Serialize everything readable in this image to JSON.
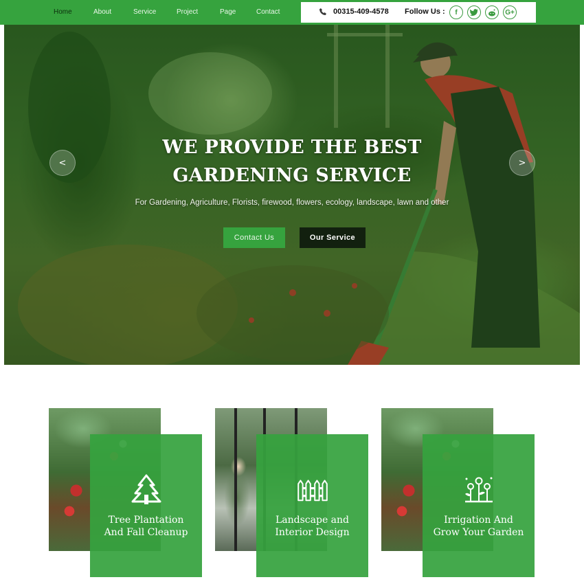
{
  "nav": {
    "items": [
      {
        "label": "Home",
        "active": true
      },
      {
        "label": "About",
        "active": false
      },
      {
        "label": "Service",
        "active": false
      },
      {
        "label": "Project",
        "active": false
      },
      {
        "label": "Page",
        "active": false
      },
      {
        "label": "Contact",
        "active": false
      }
    ]
  },
  "contact": {
    "phone": "00315-409-4578",
    "follow_label": "Follow Us :",
    "social": [
      {
        "icon": "facebook-icon",
        "glyph": "f"
      },
      {
        "icon": "twitter-icon",
        "glyph": "t"
      },
      {
        "icon": "reddit-icon",
        "glyph": "r"
      },
      {
        "icon": "google-plus-icon",
        "glyph": "G+"
      }
    ]
  },
  "hero": {
    "title_line1": "WE PROVIDE THE BEST",
    "title_line2": "GARDENING SERVICE",
    "subtitle": "For Gardening, Agriculture, Florists, firewood, flowers, ecology, landscape, lawn and other",
    "btn_contact": "Contact Us",
    "btn_service": "Our Service",
    "prev_glyph": "<",
    "next_glyph": ">"
  },
  "services": [
    {
      "line1": "Tree Plantation",
      "line2": "And Fall Cleanup",
      "icon": "tree-icon"
    },
    {
      "line1": "Landscape and",
      "line2": "Interior Design",
      "icon": "fence-icon"
    },
    {
      "line1": "Irrigation And",
      "line2": "Grow Your Garden",
      "icon": "flowers-icon"
    }
  ],
  "colors": {
    "brand_green": "#36a33e",
    "dark_button": "#12200f",
    "white": "#ffffff"
  }
}
